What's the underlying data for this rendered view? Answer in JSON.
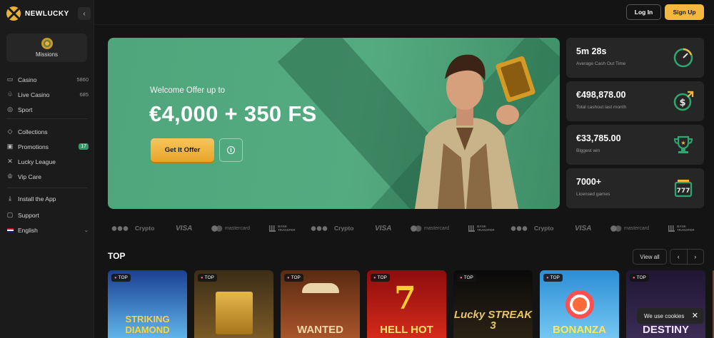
{
  "brand": {
    "name": "NEWLUCKY"
  },
  "sidebar": {
    "missions_label": "Missions",
    "items": [
      {
        "label": "Casino",
        "count": "5860",
        "icon": "casino-icon"
      },
      {
        "label": "Live Casino",
        "count": "685",
        "icon": "live-casino-icon"
      },
      {
        "label": "Sport",
        "icon": "sport-icon"
      },
      {
        "label": "Collections",
        "icon": "collections-icon"
      },
      {
        "label": "Promotions",
        "badge": "17",
        "icon": "gift-icon"
      },
      {
        "label": "Lucky League",
        "icon": "league-icon"
      },
      {
        "label": "Vip Care",
        "icon": "crown-icon"
      },
      {
        "label": "Install the App",
        "icon": "download-icon"
      },
      {
        "label": "Support",
        "icon": "chat-icon"
      },
      {
        "label": "English",
        "icon": "flag-uk-icon"
      }
    ]
  },
  "header": {
    "login_label": "Log In",
    "signup_label": "Sign Up"
  },
  "hero": {
    "subtitle": "Welcome Offer up to",
    "title": "€4,000 + 350 FS",
    "cta_label": "Get It Offer"
  },
  "stats": [
    {
      "value": "5m 28s",
      "label": "Average Cash Out Time",
      "icon": "gauge-icon"
    },
    {
      "value": "€498,878.00",
      "label": "Total cashout last month",
      "icon": "dollar-cashout-icon"
    },
    {
      "value": "€33,785.00",
      "label": "Biggest win",
      "icon": "trophy-icon"
    },
    {
      "value": "7000+",
      "label": "Licensed games",
      "icon": "slot-777-icon"
    }
  ],
  "payments": {
    "crypto": "Crypto",
    "visa": "VISA",
    "mastercard": "mastercard",
    "bank_line1": "BANK",
    "bank_line2": "TRANSFER"
  },
  "top": {
    "title": "TOP",
    "view_all": "View all",
    "tag": "TOP",
    "games": [
      {
        "title": "STRIKING DIAMOND",
        "colors": [
          "#1b3f93",
          "#5fb5ea"
        ]
      },
      {
        "title": "",
        "colors": [
          "#3b2d17",
          "#7a5a26"
        ]
      },
      {
        "title": "WANTED",
        "colors": [
          "#5a2a12",
          "#a8552a"
        ]
      },
      {
        "title": "HELL HOT",
        "colors": [
          "#8d0d0d",
          "#d42a1a"
        ]
      },
      {
        "title": "Lucky STREAK 3",
        "colors": [
          "#0a0a0a",
          "#2a2214"
        ]
      },
      {
        "title": "BONANZA",
        "colors": [
          "#2c8ed6",
          "#75c7f2"
        ]
      },
      {
        "title": "DESTINY",
        "colors": [
          "#1f1633",
          "#3b2c55"
        ]
      }
    ]
  },
  "cookie": {
    "text": "We use cookies"
  }
}
